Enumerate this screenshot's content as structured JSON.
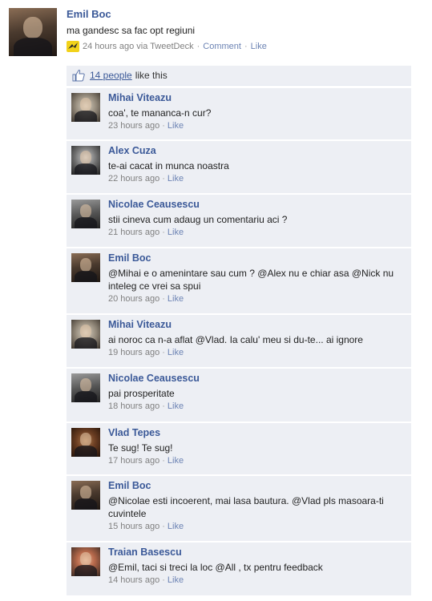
{
  "post": {
    "author": "Emil Boc",
    "text": "ma gandesc sa fac opt regiuni",
    "time": "24 hours ago via TweetDeck",
    "comment_label": "Comment",
    "like_label": "Like",
    "separator": "·"
  },
  "likes": {
    "count_link": "14 people",
    "suffix": "like this"
  },
  "comments": [
    {
      "author": "Mihai Viteazu",
      "text": "coa', te mananca-n cur?",
      "time": "23 hours ago",
      "like_label": "Like",
      "avatar": "mihai"
    },
    {
      "author": "Alex Cuza",
      "text": "te-ai cacat in munca noastra",
      "time": "22 hours ago",
      "like_label": "Like",
      "avatar": "cuza"
    },
    {
      "author": "Nicolae Ceausescu",
      "text": "stii cineva cum adaug un comentariu aci ?",
      "time": "21 hours ago",
      "like_label": "Like",
      "avatar": "ceau"
    },
    {
      "author": "Emil Boc",
      "text": "@Mihai e o amenintare sau cum ? @Alex nu e chiar asa @Nick nu inteleg ce vrei sa spui",
      "time": "20 hours ago",
      "like_label": "Like",
      "avatar": "boc"
    },
    {
      "author": "Mihai Viteazu",
      "text": "ai noroc ca n-a aflat @Vlad. Ia calu' meu si du-te... ai ignore",
      "time": "19 hours ago",
      "like_label": "Like",
      "avatar": "mihai"
    },
    {
      "author": "Nicolae Ceausescu",
      "text": "pai prosperitate",
      "time": "18 hours ago",
      "like_label": "Like",
      "avatar": "ceau"
    },
    {
      "author": "Vlad Tepes",
      "text": "Te sug! Te sug!",
      "time": "17 hours ago",
      "like_label": "Like",
      "avatar": "vlad"
    },
    {
      "author": "Emil Boc",
      "text": "@Nicolae esti incoerent, mai lasa bautura. @Vlad pls masoara-ti cuvintele",
      "time": "15 hours ago",
      "like_label": "Like",
      "avatar": "boc"
    },
    {
      "author": "Traian Basescu",
      "text": "@Emil, taci si treci la loc @All , tx pentru feedback",
      "time": "14 hours ago",
      "like_label": "Like",
      "avatar": "traian"
    }
  ],
  "colors": {
    "name": "#3b5998",
    "comment_bg": "#edeff4",
    "meta": "#808080",
    "link": "#6d84b4"
  },
  "icons": {
    "tweetdeck": "tweetdeck-icon",
    "like": "thumbs-up-icon"
  }
}
